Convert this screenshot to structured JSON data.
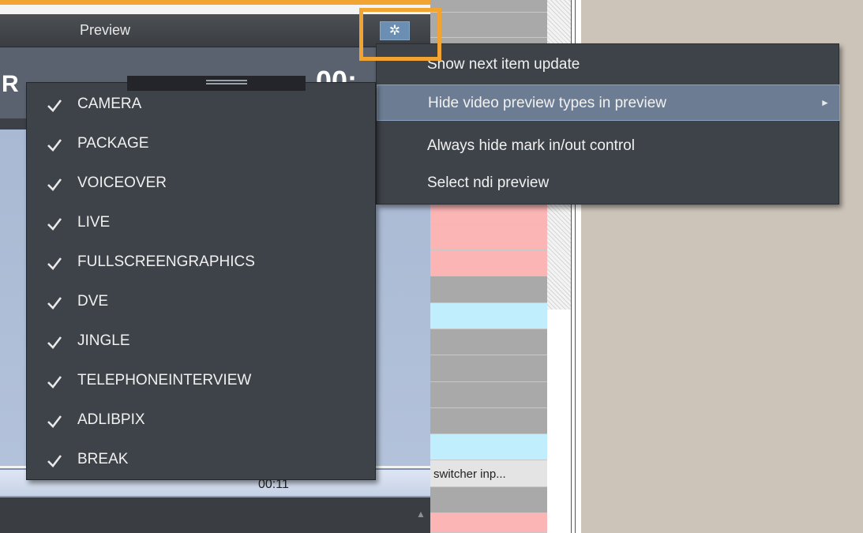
{
  "preview": {
    "title": "Preview",
    "letter": "R",
    "time_partial": "00:",
    "strip_time": "00:11"
  },
  "rundown": {
    "switcher_text": "switcher inp..."
  },
  "context_menu": {
    "items": [
      {
        "label": "Show next item update"
      },
      {
        "label": "Hide video preview types in preview",
        "has_submenu": true,
        "active": true
      },
      {
        "label": "Always hide mark in/out control"
      },
      {
        "label": "Select ndi preview"
      }
    ],
    "submenu_arrow": "►"
  },
  "submenu": {
    "items": [
      {
        "label": "CAMERA",
        "checked": true
      },
      {
        "label": "PACKAGE",
        "checked": true
      },
      {
        "label": "VOICEOVER",
        "checked": true
      },
      {
        "label": "LIVE",
        "checked": true
      },
      {
        "label": "FULLSCREENGRAPHICS",
        "checked": true
      },
      {
        "label": "DVE",
        "checked": true
      },
      {
        "label": "JINGLE",
        "checked": true
      },
      {
        "label": "TELEPHONEINTERVIEW",
        "checked": true
      },
      {
        "label": "ADLIBPIX",
        "checked": true
      },
      {
        "label": "BREAK",
        "checked": true
      }
    ]
  },
  "icons": {
    "gear": "gear-icon",
    "check": "checkmark-icon",
    "scroll_up": "scroll-up-arrow-icon"
  },
  "colors": {
    "accent": "#f2a433",
    "menu_bg": "#3e4349",
    "menu_active": "#6c7d93",
    "row_cyan": "#c0eefc",
    "row_pink": "#fbb5b5",
    "row_gray": "#a9a9a9"
  }
}
